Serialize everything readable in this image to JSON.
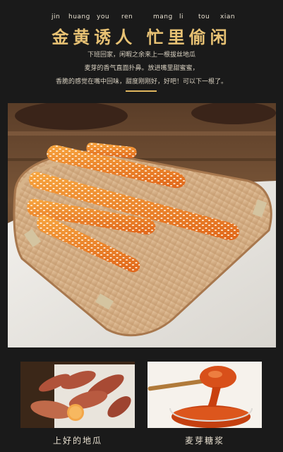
{
  "header": {
    "pinyin": [
      "jin",
      "huang",
      "you",
      "ren",
      "mang",
      "li",
      "tou",
      "xian"
    ],
    "title": "金黄诱人 忙里偷闲",
    "description_lines": [
      "下班回家，闲暇之余来上一根拔丝地瓜",
      "麦芽的香气直面扑鼻。放进嘴里甜蜜蜜，",
      "香脆的感觉在嘴中回味，甜度刚刚好，好吧！可以下一根了。"
    ]
  },
  "hero": {
    "subject": "candied-sweet-potato-sticks-on-bamboo-basket"
  },
  "thumbnails": [
    {
      "caption": "上好的地瓜",
      "subject": "sweet-potatoes"
    },
    {
      "caption": "麦芽糖浆",
      "subject": "malt-syrup-dripping-from-spoon"
    }
  ],
  "colors": {
    "background": "#1a1a1a",
    "title_gold": "#e8c274",
    "divider_gold": "#e0b65f",
    "text_light": "#e8e0d0"
  }
}
